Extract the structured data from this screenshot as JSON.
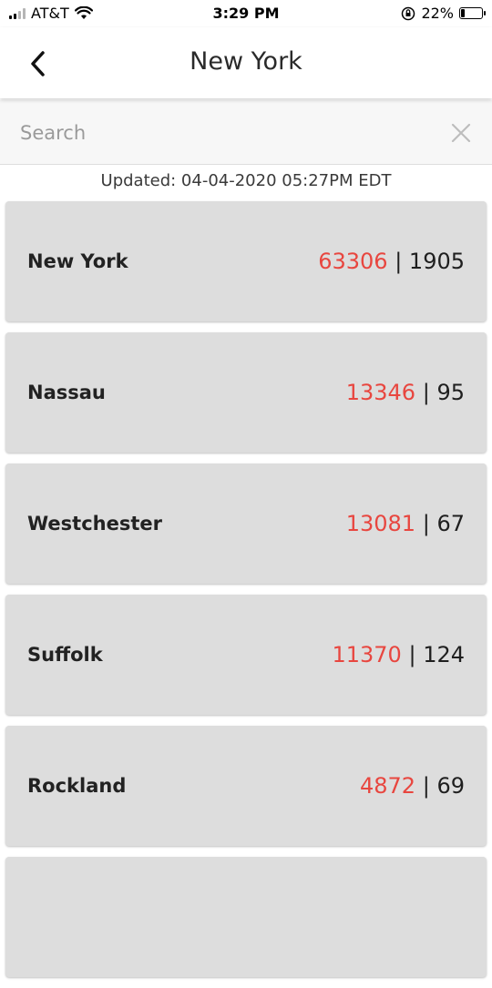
{
  "status_bar": {
    "carrier": "AT&T",
    "time": "3:29 PM",
    "battery": "22%",
    "battery_level": 0.22
  },
  "header": {
    "title": "New York",
    "back_icon": "chevron-left-icon"
  },
  "search": {
    "placeholder": "Search",
    "value": "",
    "clear_icon": "close-icon"
  },
  "updated": "Updated: 04-04-2020 05:27PM EDT",
  "colors": {
    "cases": "#e8463f",
    "card_bg": "#dddddd"
  },
  "counties": [
    {
      "name": "New York",
      "cases": "63306",
      "separator": "|",
      "deaths": "1905"
    },
    {
      "name": "Nassau",
      "cases": "13346",
      "separator": "|",
      "deaths": "95"
    },
    {
      "name": "Westchester",
      "cases": "13081",
      "separator": "|",
      "deaths": "67"
    },
    {
      "name": "Suffolk",
      "cases": "11370",
      "separator": "|",
      "deaths": "124"
    },
    {
      "name": "Rockland",
      "cases": "4872",
      "separator": "|",
      "deaths": "69"
    }
  ]
}
